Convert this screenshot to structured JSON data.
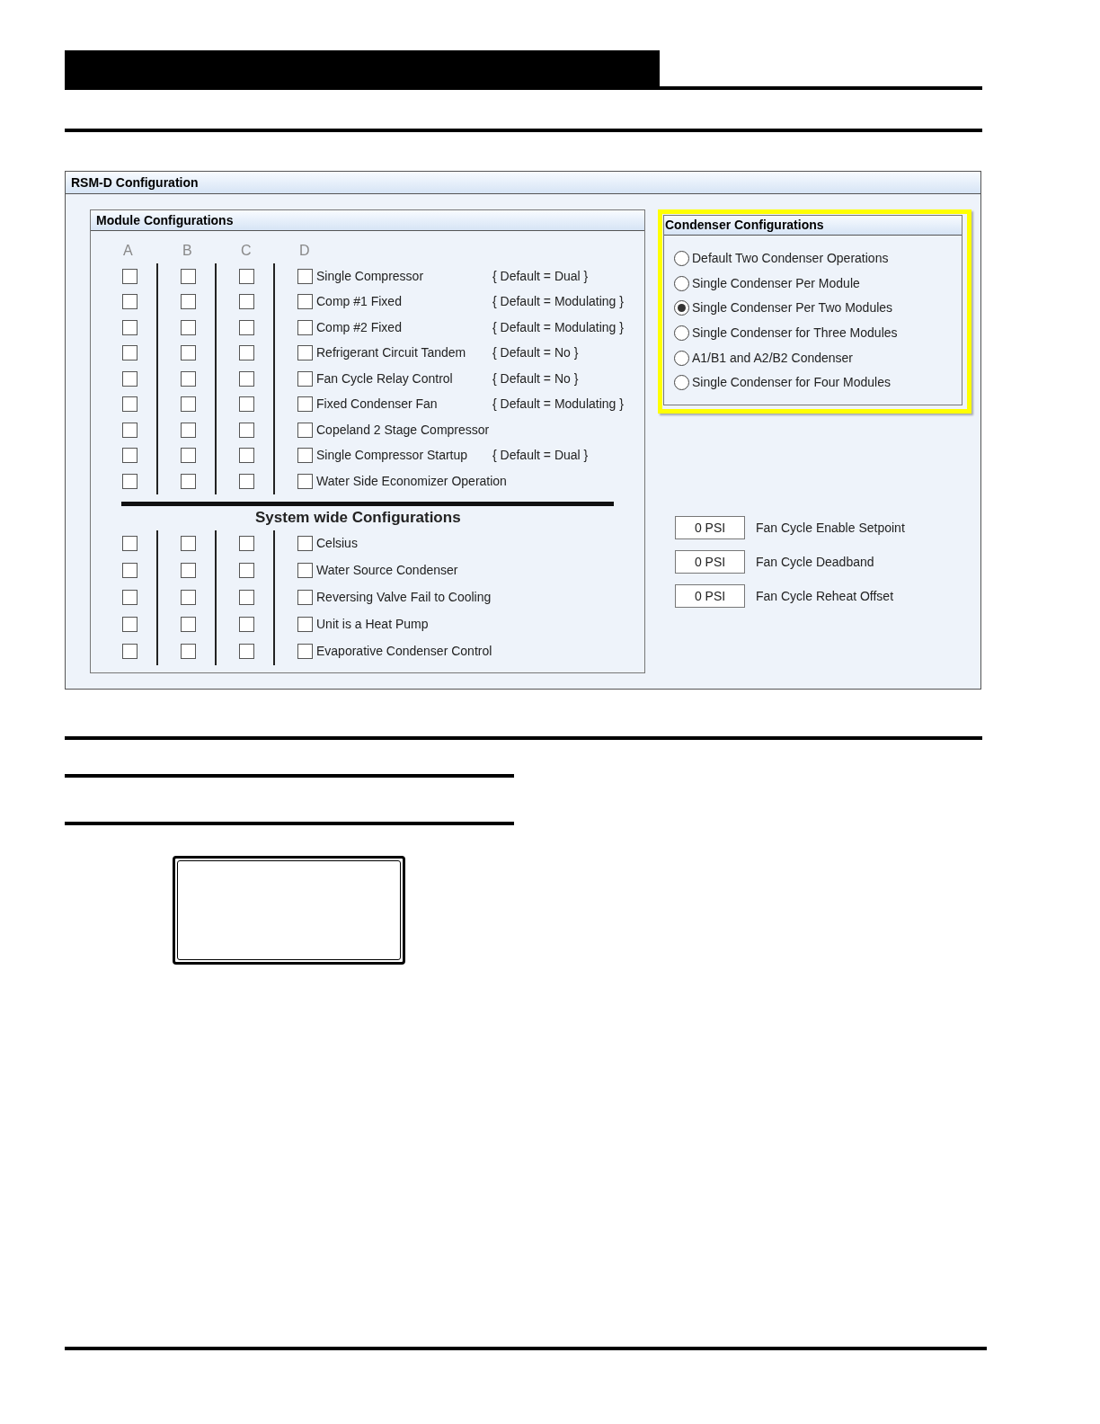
{
  "window": {
    "title": "RSM-D Configuration"
  },
  "module_configurations": {
    "title": "Module Configurations",
    "columns": [
      "A",
      "B",
      "C",
      "D"
    ],
    "rows": [
      {
        "label": "Single Compressor",
        "default": "{ Default = Dual }",
        "checks": [
          false,
          false,
          false,
          false
        ]
      },
      {
        "label": "Comp #1 Fixed",
        "default": "{ Default = Modulating }",
        "checks": [
          false,
          false,
          false,
          false
        ]
      },
      {
        "label": "Comp #2 Fixed",
        "default": "{ Default = Modulating }",
        "checks": [
          false,
          false,
          false,
          false
        ]
      },
      {
        "label": "Refrigerant Circuit Tandem",
        "default": "{ Default = No }",
        "checks": [
          false,
          false,
          false,
          false
        ]
      },
      {
        "label": "Fan Cycle Relay Control",
        "default": "{ Default = No }",
        "checks": [
          false,
          false,
          false,
          false
        ]
      },
      {
        "label": "Fixed Condenser Fan",
        "default": "{ Default = Modulating }",
        "checks": [
          false,
          false,
          false,
          false
        ]
      },
      {
        "label": "Copeland 2 Stage Compressor",
        "checks": [
          false,
          false,
          false,
          false
        ]
      },
      {
        "label": "Single Compressor Startup",
        "default": "{ Default = Dual }",
        "checks": [
          false,
          false,
          false,
          false
        ]
      },
      {
        "label": "Water Side Economizer Operation",
        "checks": [
          false,
          false,
          false,
          false
        ]
      }
    ]
  },
  "system_wide": {
    "title": "System wide Configurations",
    "rows": [
      {
        "label": "Celsius",
        "checks": [
          false,
          false,
          false,
          false
        ]
      },
      {
        "label": "Water Source Condenser",
        "checks": [
          false,
          false,
          false,
          false
        ]
      },
      {
        "label": "Reversing Valve Fail to Cooling",
        "checks": [
          false,
          false,
          false,
          false
        ]
      },
      {
        "label": "Unit is a Heat Pump",
        "checks": [
          false,
          false,
          false,
          false
        ]
      },
      {
        "label": "Evaporative Condenser Control",
        "checks": [
          false,
          false,
          false,
          false
        ]
      }
    ]
  },
  "condenser_configurations": {
    "title": "Condenser Configurations",
    "options": [
      {
        "label": "Default Two Condenser Operations",
        "selected": false
      },
      {
        "label": "Single Condenser Per Module",
        "selected": false
      },
      {
        "label": "Single Condenser Per Two Modules",
        "selected": true
      },
      {
        "label": "Single Condenser for Three Modules",
        "selected": false
      },
      {
        "label": "A1/B1 and A2/B2 Condenser",
        "selected": false
      },
      {
        "label": "Single Condenser for Four Modules",
        "selected": false
      }
    ]
  },
  "setpoints": [
    {
      "value": "0 PSI",
      "label": "Fan Cycle Enable Setpoint"
    },
    {
      "value": "0 PSI",
      "label": "Fan Cycle Deadband"
    },
    {
      "value": "0 PSI",
      "label": "Fan Cycle Reheat Offset"
    }
  ]
}
